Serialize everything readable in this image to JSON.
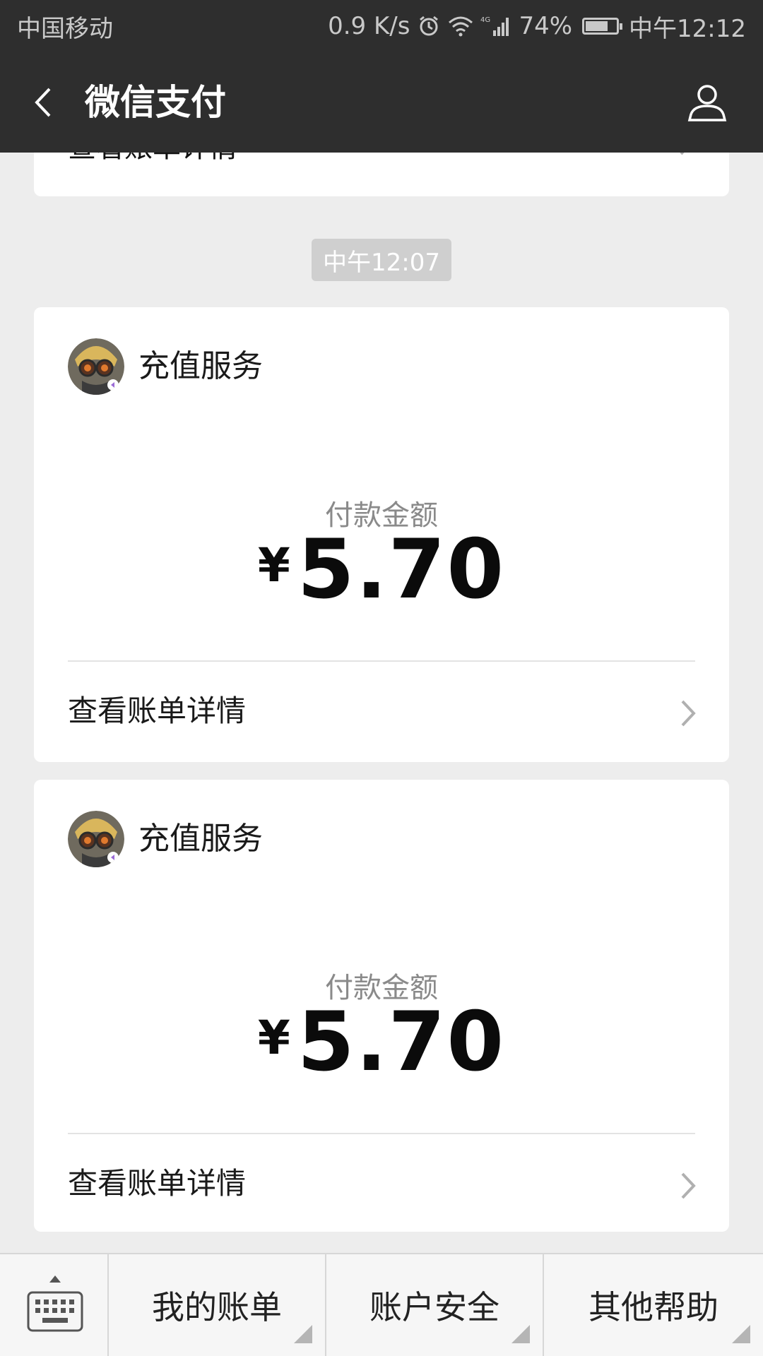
{
  "status_bar": {
    "carrier": "中国移动",
    "net_speed": "0.9 K/s",
    "battery_pct": "74%",
    "battery_level": 0.74,
    "time": "中午12:12",
    "icons": [
      "alarm-icon",
      "wifi-icon",
      "4g-signal-icon",
      "battery-icon"
    ]
  },
  "nav": {
    "title": "微信支付",
    "back_icon": "chevron-left-icon",
    "profile_icon": "person-icon"
  },
  "partial_card": {
    "label": "查看账单详情"
  },
  "timestamp": "中午12:07",
  "cards": [
    {
      "merchant": "充值服务",
      "amount_label": "付款金额",
      "currency": "¥",
      "amount": "5.70",
      "detail_label": "查看账单详情"
    },
    {
      "merchant": "充值服务",
      "amount_label": "付款金额",
      "currency": "¥",
      "amount": "5.70",
      "detail_label": "查看账单详情"
    }
  ],
  "bottom_bar": {
    "keyboard_icon": "keyboard-icon",
    "menus": [
      "我的账单",
      "账户安全",
      "其他帮助"
    ]
  },
  "colors": {
    "header": "#2e2e2e",
    "background": "#ededed",
    "card": "#ffffff"
  }
}
